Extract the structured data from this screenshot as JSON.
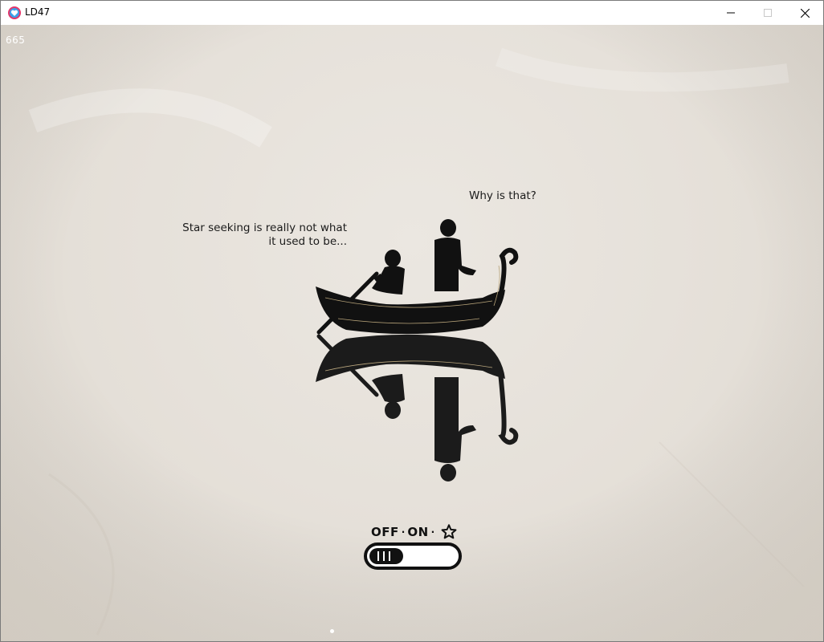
{
  "window": {
    "title": "LD47",
    "minimize_icon": "minimize-icon",
    "maximize_icon": "maximize-icon",
    "close_icon": "close-icon"
  },
  "hud": {
    "fps_counter": "665"
  },
  "dialogue": {
    "left_line1": "Star seeking is really not what",
    "left_line2": "it used to be...",
    "right": "Why is that?"
  },
  "toggle": {
    "off_label": "OFF",
    "separator": "·",
    "on_label": "ON",
    "star_icon": "star-icon",
    "state": "off"
  },
  "colors": {
    "background": "#e6e1da",
    "silhouette": "#111111",
    "boat_trim": "#b8a47a",
    "app_icon": "#e2366b"
  }
}
